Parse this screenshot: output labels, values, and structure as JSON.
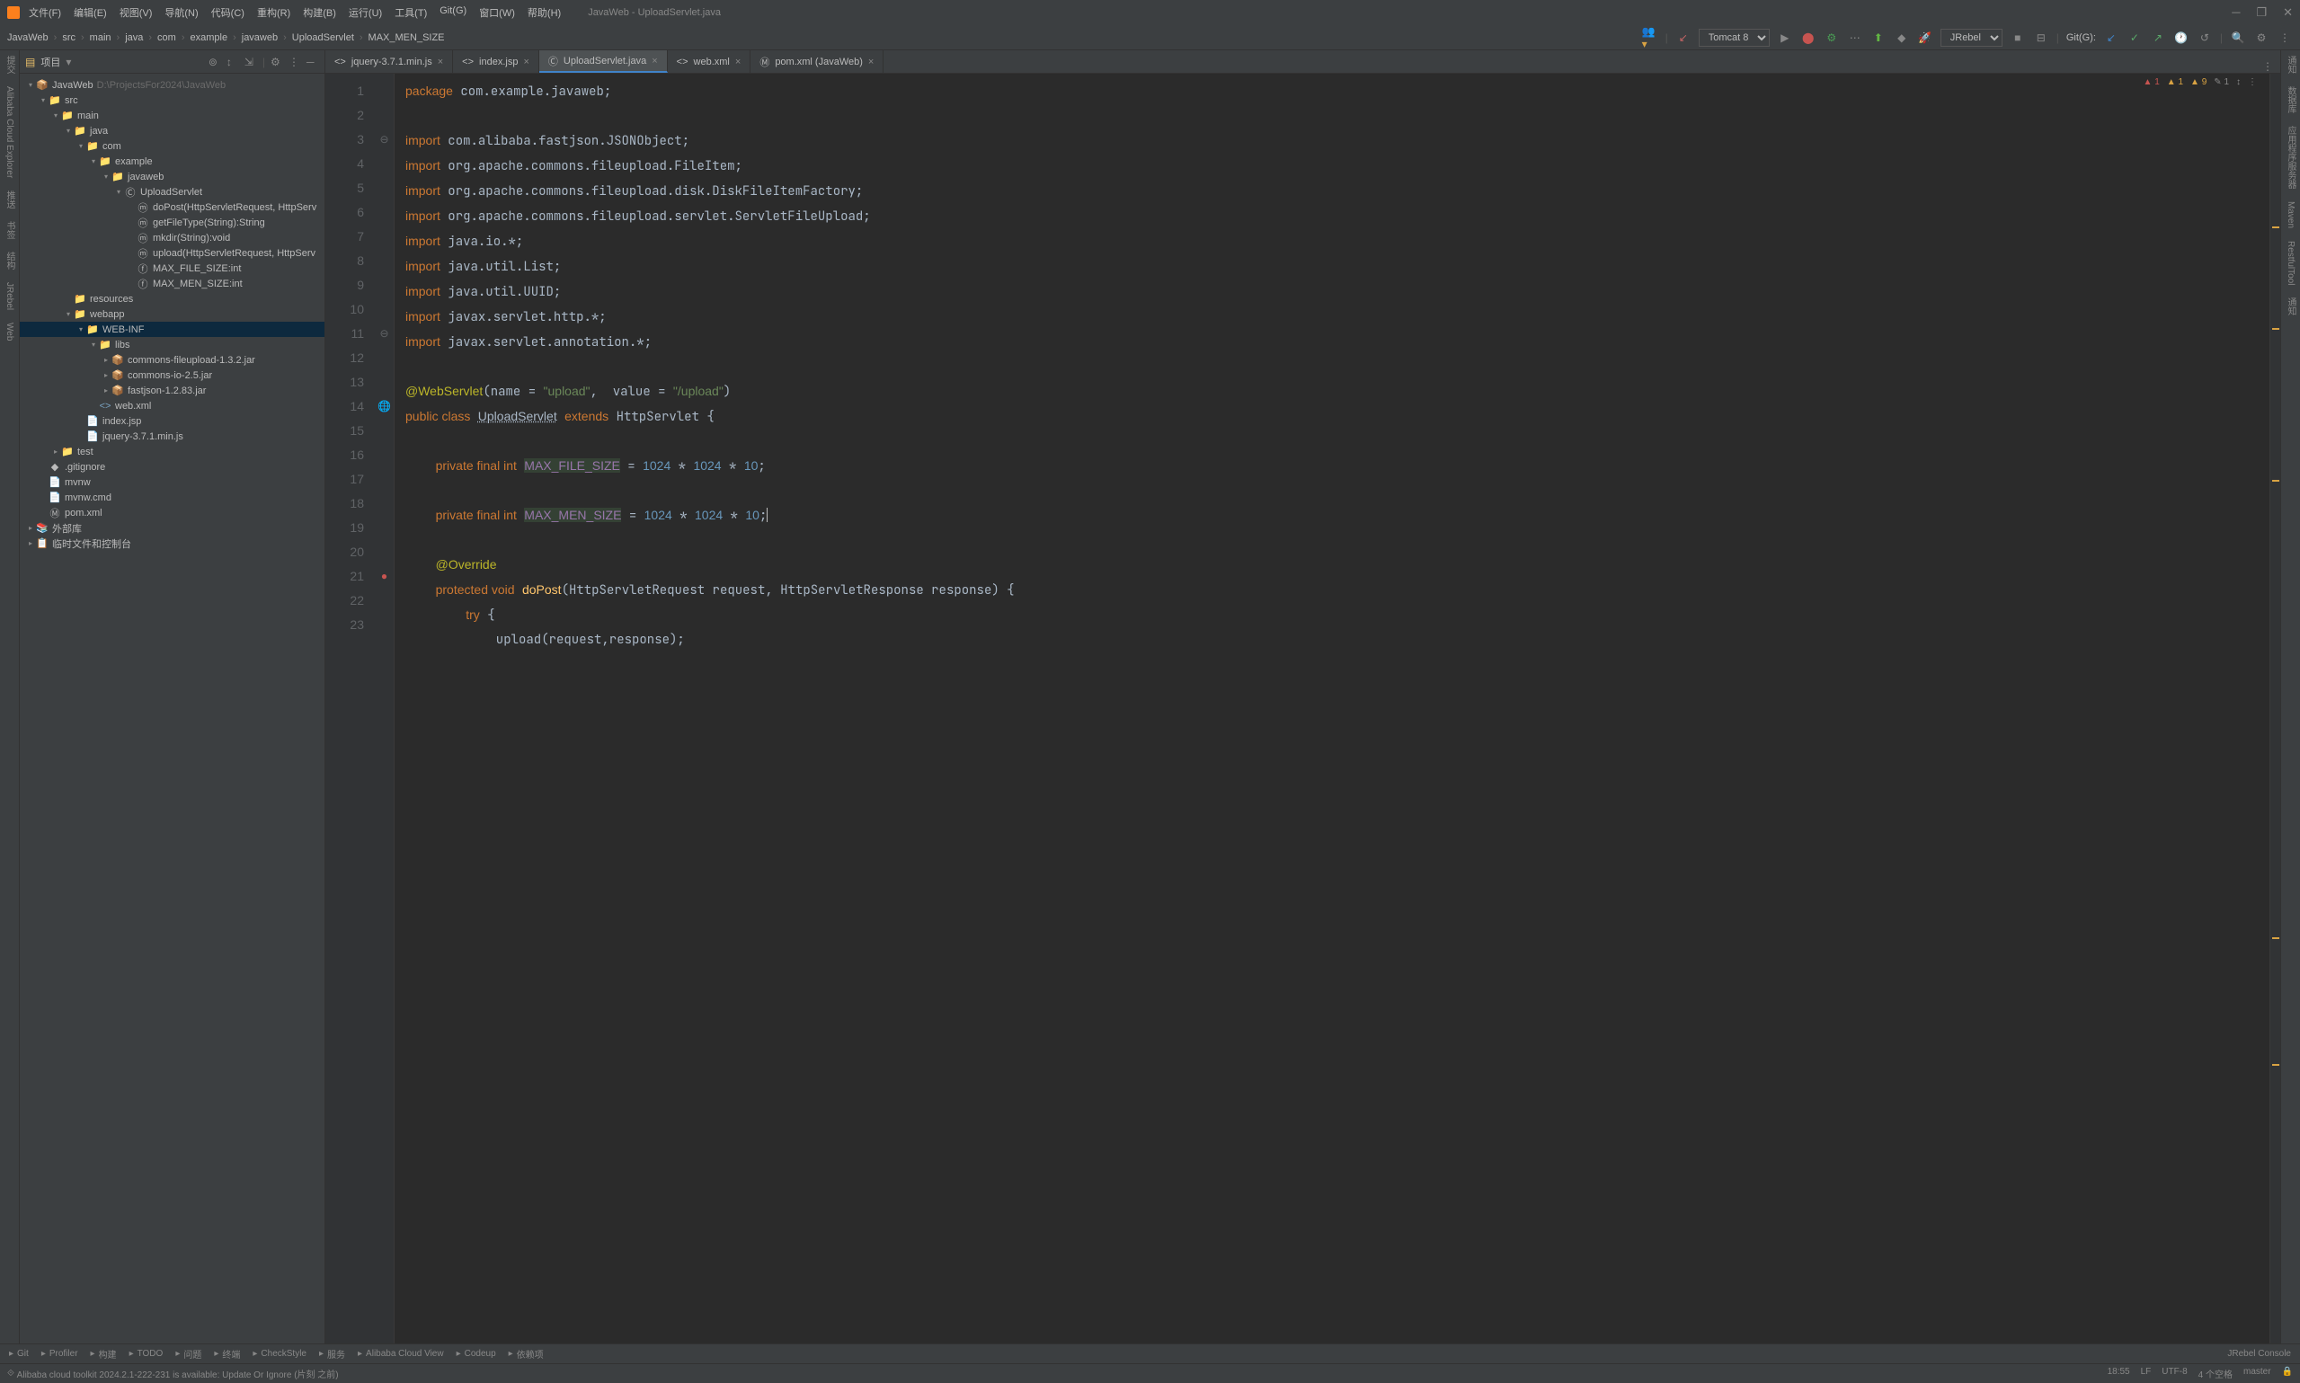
{
  "window_title": "JavaWeb - UploadServlet.java",
  "menu": [
    "文件(F)",
    "编辑(E)",
    "视图(V)",
    "导航(N)",
    "代码(C)",
    "重构(R)",
    "构建(B)",
    "运行(U)",
    "工具(T)",
    "Git(G)",
    "窗口(W)",
    "帮助(H)"
  ],
  "breadcrumb": [
    "JavaWeb",
    "src",
    "main",
    "java",
    "com",
    "example",
    "javaweb",
    "UploadServlet",
    "MAX_MEN_SIZE"
  ],
  "run_config": "Tomcat 8",
  "jrebel": "JRebel",
  "git_label": "Git(G):",
  "tree_title": "项目",
  "tree": [
    {
      "d": 0,
      "ar": "▾",
      "ic": "📦",
      "name": "JavaWeb",
      "hint": "D:\\ProjectsFor2024\\JavaWeb"
    },
    {
      "d": 1,
      "ar": "▾",
      "ic": "📁",
      "name": "src",
      "cls": "fld"
    },
    {
      "d": 2,
      "ar": "▾",
      "ic": "📁",
      "name": "main",
      "cls": "fld"
    },
    {
      "d": 3,
      "ar": "▾",
      "ic": "📁",
      "name": "java",
      "cls": "fld"
    },
    {
      "d": 4,
      "ar": "▾",
      "ic": "📁",
      "name": "com",
      "cls": "pkg"
    },
    {
      "d": 5,
      "ar": "▾",
      "ic": "📁",
      "name": "example",
      "cls": "pkg"
    },
    {
      "d": 6,
      "ar": "▾",
      "ic": "📁",
      "name": "javaweb",
      "cls": "pkg"
    },
    {
      "d": 7,
      "ar": "▾",
      "ic": "Ⓒ",
      "name": "UploadServlet"
    },
    {
      "d": 8,
      "ar": "",
      "ic": "ⓜ",
      "name": "doPost(HttpServletRequest, HttpServ"
    },
    {
      "d": 8,
      "ar": "",
      "ic": "ⓜ",
      "name": "getFileType(String):String"
    },
    {
      "d": 8,
      "ar": "",
      "ic": "ⓜ",
      "name": "mkdir(String):void"
    },
    {
      "d": 8,
      "ar": "",
      "ic": "ⓜ",
      "name": "upload(HttpServletRequest, HttpServ"
    },
    {
      "d": 8,
      "ar": "",
      "ic": "ⓕ",
      "name": "MAX_FILE_SIZE:int"
    },
    {
      "d": 8,
      "ar": "",
      "ic": "ⓕ",
      "name": "MAX_MEN_SIZE:int"
    },
    {
      "d": 3,
      "ar": "",
      "ic": "📁",
      "name": "resources",
      "cls": "fld"
    },
    {
      "d": 3,
      "ar": "▾",
      "ic": "📁",
      "name": "webapp",
      "cls": "fld"
    },
    {
      "d": 4,
      "ar": "▾",
      "ic": "📁",
      "name": "WEB-INF",
      "sel": true,
      "cls": "fld"
    },
    {
      "d": 5,
      "ar": "▾",
      "ic": "📁",
      "name": "libs",
      "cls": "fld"
    },
    {
      "d": 6,
      "ar": "▸",
      "ic": "📦",
      "name": "commons-fileupload-1.3.2.jar",
      "cls": "jar"
    },
    {
      "d": 6,
      "ar": "▸",
      "ic": "📦",
      "name": "commons-io-2.5.jar",
      "cls": "jar"
    },
    {
      "d": 6,
      "ar": "▸",
      "ic": "📦",
      "name": "fastjson-1.2.83.jar",
      "cls": "jar"
    },
    {
      "d": 5,
      "ar": "",
      "ic": "<>",
      "name": "web.xml",
      "cls": "xml"
    },
    {
      "d": 4,
      "ar": "",
      "ic": "📄",
      "name": "index.jsp"
    },
    {
      "d": 4,
      "ar": "",
      "ic": "📄",
      "name": "jquery-3.7.1.min.js"
    },
    {
      "d": 2,
      "ar": "▸",
      "ic": "📁",
      "name": "test",
      "cls": "fld"
    },
    {
      "d": 1,
      "ar": "",
      "ic": "◆",
      "name": ".gitignore"
    },
    {
      "d": 1,
      "ar": "",
      "ic": "📄",
      "name": "mvnw"
    },
    {
      "d": 1,
      "ar": "",
      "ic": "📄",
      "name": "mvnw.cmd"
    },
    {
      "d": 1,
      "ar": "",
      "ic": "Ⓜ",
      "name": "pom.xml"
    },
    {
      "d": 0,
      "ar": "▸",
      "ic": "📚",
      "name": "外部库"
    },
    {
      "d": 0,
      "ar": "▸",
      "ic": "📋",
      "name": "临时文件和控制台"
    }
  ],
  "editor_tabs": [
    {
      "icon": "<>",
      "name": "jquery-3.7.1.min.js",
      "close": true
    },
    {
      "icon": "<>",
      "name": "index.jsp",
      "close": true
    },
    {
      "icon": "Ⓒ",
      "name": "UploadServlet.java",
      "close": true,
      "active": true
    },
    {
      "icon": "<>",
      "name": "web.xml",
      "close": true
    },
    {
      "icon": "Ⓜ",
      "name": "pom.xml (JavaWeb)",
      "close": true
    }
  ],
  "line_nos": [
    1,
    2,
    3,
    4,
    5,
    6,
    7,
    8,
    9,
    10,
    11,
    12,
    13,
    14,
    15,
    16,
    17,
    18,
    19,
    20,
    21,
    22,
    23
  ],
  "inspect": {
    "err": "1",
    "warn": "1",
    "weak": "9",
    "typo": "1"
  },
  "left_tools": [
    "提交",
    "Alibaba Cloud Explorer",
    "推送",
    "书签",
    "结构",
    "JRebel",
    "Web"
  ],
  "right_tools": [
    "通知",
    "数据库",
    "应用程序服务器",
    "Maven",
    "RestfulTool",
    "通知"
  ],
  "bottom_tools": [
    "Git",
    "Profiler",
    "构建",
    "TODO",
    "问题",
    "终端",
    "CheckStyle",
    "服务",
    "Alibaba Cloud View",
    "Codeup",
    "依赖项"
  ],
  "bottom_right": "JRebel Console",
  "status_msg": "Alibaba cloud toolkit 2024.2.1-222-231 is available: Update Or Ignore (片刻 之前)",
  "status_right": [
    "18:55",
    "LF",
    "UTF-8",
    "4 个空格",
    "master"
  ]
}
